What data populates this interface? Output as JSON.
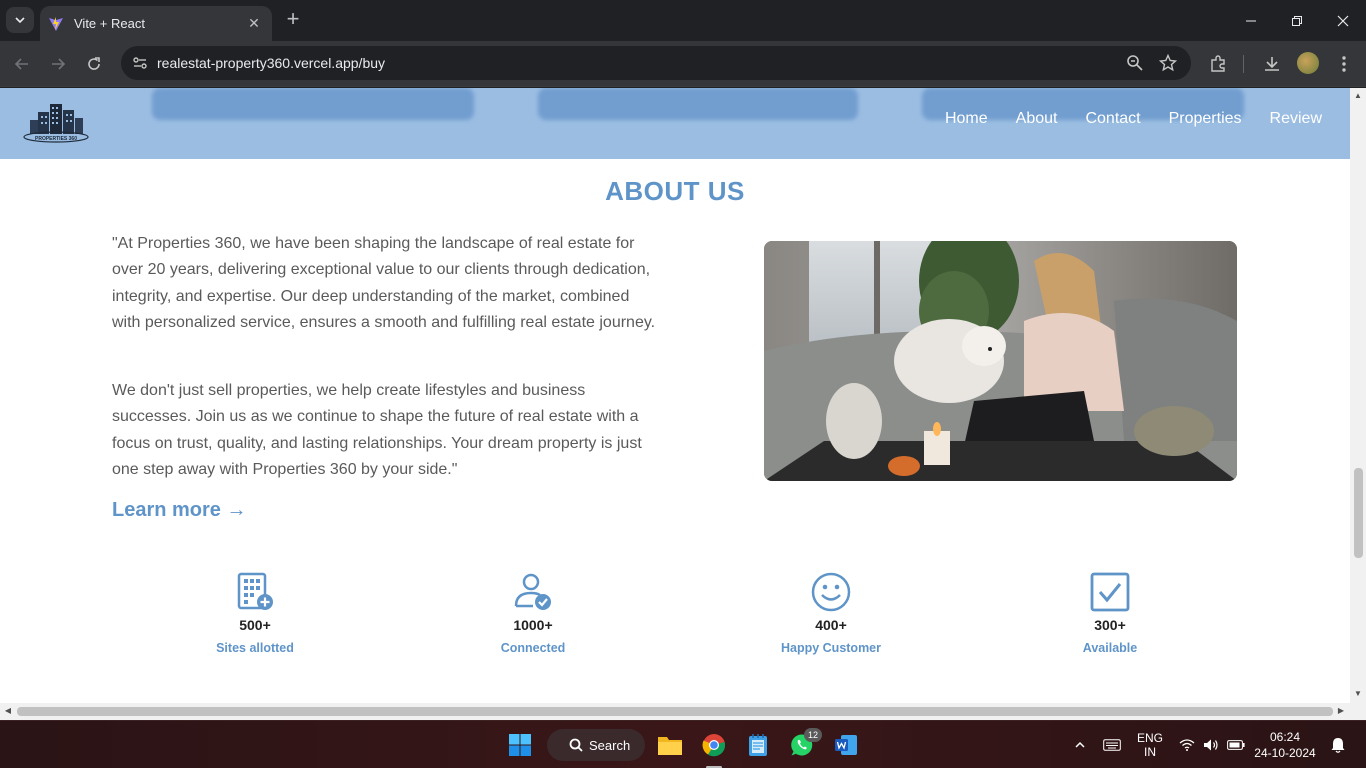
{
  "browser": {
    "tab_title": "Vite + React",
    "url": "realestat-property360.vercel.app/buy"
  },
  "site": {
    "logo_text": "PROPERTIES 360",
    "nav": [
      "Home",
      "About",
      "Contact",
      "Properties",
      "Review"
    ]
  },
  "about": {
    "title": "ABOUT US",
    "paragraph1": "\"At Properties 360, we have been shaping the landscape of real estate for over 20 years, delivering exceptional value to our clients through dedication, integrity, and expertise. Our deep understanding of the market, combined with personalized service, ensures a smooth and fulfilling real estate journey.",
    "paragraph2": "We don't just sell properties, we help create lifestyles and business successes. Join us as we continue to shape the future of real estate with a focus on trust, quality, and lasting relationships. Your dream property is just one step away with Properties 360 by your side.\"",
    "learn_more": "Learn more →"
  },
  "stats": [
    {
      "icon": "building-plus-icon",
      "value": "500+",
      "label": "Sites allotted"
    },
    {
      "icon": "user-check-icon",
      "value": "1000+",
      "label": "Connected"
    },
    {
      "icon": "smiley-icon",
      "value": "400+",
      "label": "Happy Customer"
    },
    {
      "icon": "checkbox-icon",
      "value": "300+",
      "label": "Available"
    }
  ],
  "taskbar": {
    "search_label": "Search",
    "whatsapp_badge": "12",
    "lang_line1": "ENG",
    "lang_line2": "IN",
    "time": "06:24",
    "date": "24-10-2024"
  },
  "colors": {
    "accent": "#5f94c9",
    "navbar": "#9bbde2"
  }
}
